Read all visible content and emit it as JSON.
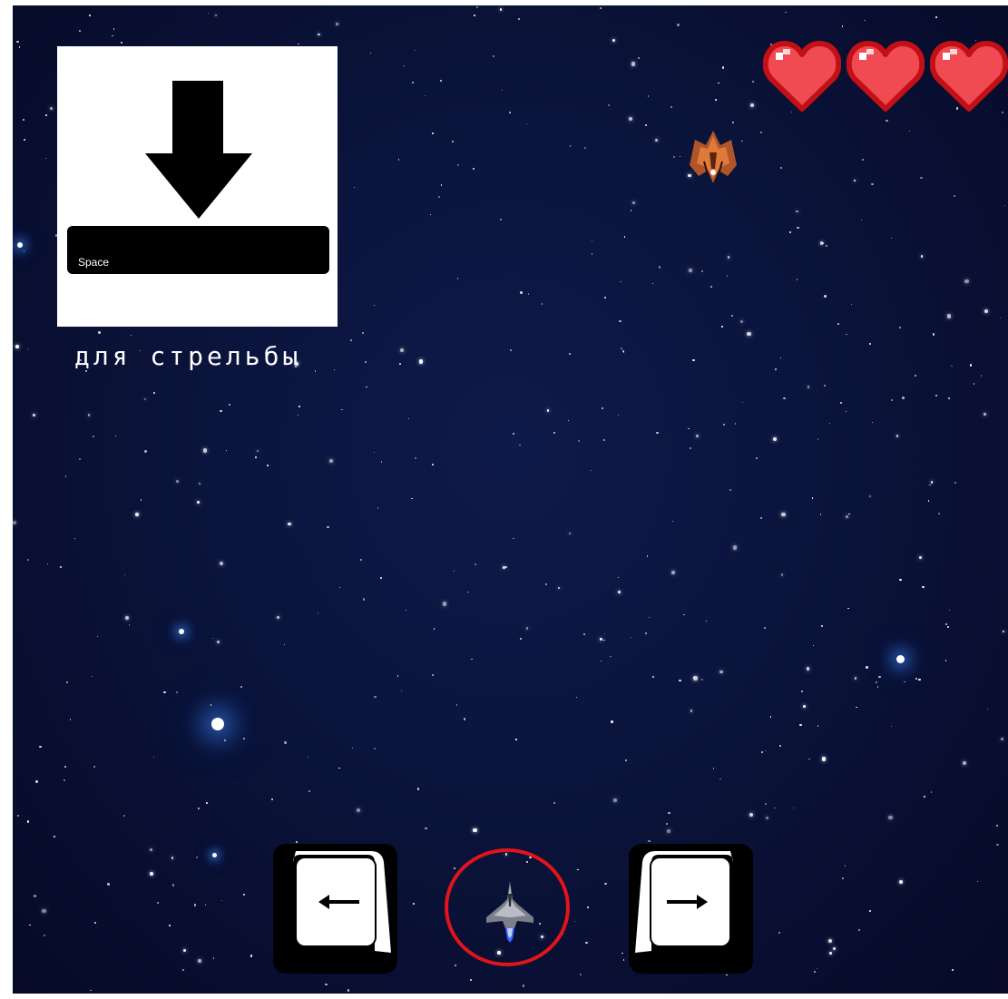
{
  "controls": {
    "shoot_key_label": "Space",
    "shoot_caption": "для стрельбы",
    "left_key_glyph": "←",
    "right_key_glyph": "→"
  },
  "player": {
    "lives": 3,
    "max_lives": 3
  },
  "colors": {
    "space_background": "#0a1238",
    "heart_fill": "#f04a52",
    "heart_outline": "#c30f16",
    "player_ring": "#e0141a",
    "key_face": "#ffffff",
    "key_body": "#000000"
  },
  "icons": [
    "down-arrow-icon",
    "heart-icon",
    "enemy-ship-icon",
    "player-ship-icon",
    "left-arrow-key-icon",
    "right-arrow-key-icon"
  ]
}
